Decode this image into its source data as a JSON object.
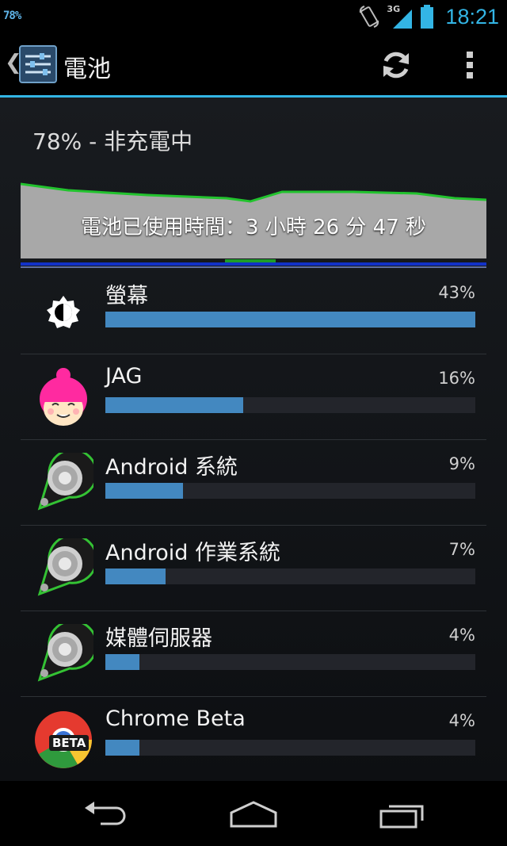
{
  "status_bar": {
    "battery_text": "78%",
    "network": "3G",
    "time": "18:21",
    "icons": [
      "rotation-icon",
      "signal-icon",
      "battery-icon"
    ]
  },
  "action_bar": {
    "title": "電池",
    "icons": [
      "settings-app-icon",
      "refresh-icon",
      "overflow-menu-icon"
    ]
  },
  "battery": {
    "status": "78% - 非充電中",
    "usage_time": "電池已使用時間：3 小時 26 分 47 秒"
  },
  "chart_data": {
    "type": "area",
    "title": "",
    "line_color": "#22c32e",
    "fill_color": "#a8a8a8"
  },
  "apps": [
    {
      "name": "螢幕",
      "percent_label": "43%",
      "value": 43,
      "icon": "brightness-icon"
    },
    {
      "name": "JAG",
      "percent_label": "16%",
      "value": 16,
      "icon": "jag-avatar-icon"
    },
    {
      "name": "Android 系統",
      "percent_label": "9%",
      "value": 9,
      "icon": "android-system-icon"
    },
    {
      "name": "Android 作業系統",
      "percent_label": "7%",
      "value": 7,
      "icon": "android-os-icon"
    },
    {
      "name": "媒體伺服器",
      "percent_label": "4%",
      "value": 4,
      "icon": "media-server-icon"
    },
    {
      "name": "Chrome Beta",
      "percent_label": "4%",
      "value": 4,
      "icon": "chrome-beta-icon",
      "icon_badge": "BETA"
    }
  ],
  "nav_bar": {
    "icons": [
      "back-icon",
      "home-icon",
      "recents-icon"
    ]
  },
  "colors": {
    "accent": "#33b5e5",
    "bar_fill": "#4388c0",
    "bar_track": "#23252b"
  }
}
